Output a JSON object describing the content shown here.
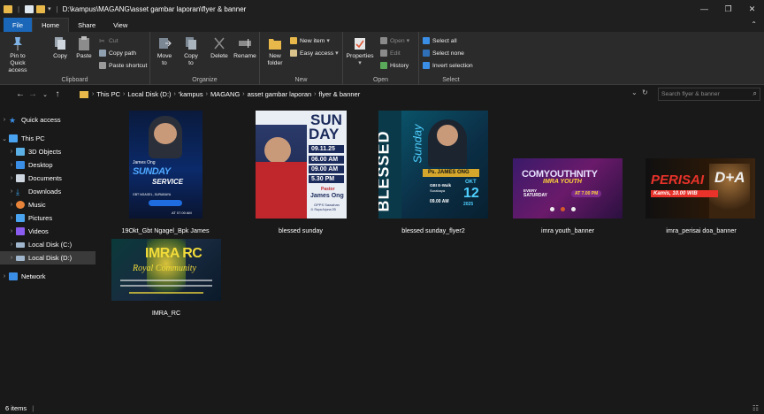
{
  "window": {
    "path": "D:\\kampus\\MAGANG\\asset gambar laporan\\flyer & banner",
    "minimize": "—",
    "maximize": "❐",
    "close": "✕"
  },
  "tabs": [
    "File",
    "Home",
    "Share",
    "View"
  ],
  "ribbon": {
    "clipboard": {
      "label": "Clipboard",
      "pin": [
        "Pin to Quick",
        "access"
      ],
      "copy": "Copy",
      "paste": "Paste",
      "cut": "Cut",
      "copy_path": "Copy path",
      "paste_shortcut": "Paste shortcut"
    },
    "organize": {
      "label": "Organize",
      "move_to": [
        "Move",
        "to"
      ],
      "copy_to": [
        "Copy",
        "to"
      ],
      "delete": "Delete",
      "rename": "Rename"
    },
    "new": {
      "label": "New",
      "new_folder": [
        "New",
        "folder"
      ],
      "new_item": "New item",
      "easy_access": "Easy access"
    },
    "open": {
      "label": "Open",
      "properties": "Properties",
      "open": "Open",
      "edit": "Edit",
      "history": "History"
    },
    "select": {
      "label": "Select",
      "select_all": "Select all",
      "select_none": "Select none",
      "invert": "Invert selection"
    }
  },
  "address": {
    "crumbs": [
      "This PC",
      "Local Disk (D:)",
      "'kampus",
      "MAGANG",
      "asset gambar laporan",
      "flyer & banner"
    ],
    "search_placeholder": "Search flyer & banner"
  },
  "nav": [
    {
      "label": "Quick access",
      "icon": "star-icon",
      "color": "#3b8ee6"
    },
    {
      "label": "This PC",
      "icon": "computer-icon",
      "color": "#4aa3f0"
    },
    {
      "label": "3D Objects",
      "icon": "cube-icon",
      "color": "#5bb0e6"
    },
    {
      "label": "Desktop",
      "icon": "desktop-icon",
      "color": "#3b8ee6"
    },
    {
      "label": "Documents",
      "icon": "document-icon",
      "color": "#cfd6df"
    },
    {
      "label": "Downloads",
      "icon": "download-icon",
      "color": "#3ba7f0"
    },
    {
      "label": "Music",
      "icon": "music-icon",
      "color": "#e8833a"
    },
    {
      "label": "Pictures",
      "icon": "pictures-icon",
      "color": "#4aa3f0"
    },
    {
      "label": "Videos",
      "icon": "videos-icon",
      "color": "#8a5cf0"
    },
    {
      "label": "Local Disk (C:)",
      "icon": "drive-icon",
      "color": "#9fb6cc"
    },
    {
      "label": "Local Disk (D:)",
      "icon": "drive-icon",
      "color": "#9fb6cc"
    },
    {
      "label": "Network",
      "icon": "network-icon",
      "color": "#3b8ee6"
    }
  ],
  "files": [
    {
      "name": "19Okt_Gbt Ngagel_Bpk James"
    },
    {
      "name": "blessed sunday"
    },
    {
      "name": "blessed sunday_flyer2"
    },
    {
      "name": "imra youth_banner"
    },
    {
      "name": "imra_perisai doa_banner"
    },
    {
      "name": "IMRA_RC"
    }
  ],
  "thumbs": {
    "t1": {
      "name": "James Ong",
      "title": "SUNDAY",
      "subtitle": "SERVICE",
      "church": "GBT NGAGEL, SURABAYA",
      "time": "AT 07.00 AM"
    },
    "t2": {
      "sun": "SUN",
      "day": "DAY",
      "date": "09.11.25",
      "times": [
        "06.00 AM",
        "09.00 AM",
        "5.30 PM"
      ],
      "pastor_label": "Pastor",
      "pastor": "James Ong",
      "venue": "GPPS Sawahan",
      "addr": "Jl. Raya Arjuna 2B"
    },
    "t3": {
      "blessed": "BLESSED",
      "sunday": "Sunday",
      "name": "Ps. JAMES ONG",
      "church": "GBI E-Walk",
      "city": "Surabaya",
      "time": "09.00 AM",
      "month": "OKT",
      "day": "12",
      "year": "2025"
    },
    "t4": {
      "title": "COMYOUTHNITY",
      "sub": "IMRA YOUTH",
      "every": "EVERY",
      "day": "SATURDAY",
      "time": "AT 7.00 PM"
    },
    "t5": {
      "title": "PERISAI",
      "doa": "D+A",
      "sub": "Kamis, 10.00 WIB"
    },
    "t6": {
      "title": "IMRA RC",
      "sub": "Royal Community"
    }
  },
  "status": {
    "items": "6 items",
    "divider": "|"
  }
}
